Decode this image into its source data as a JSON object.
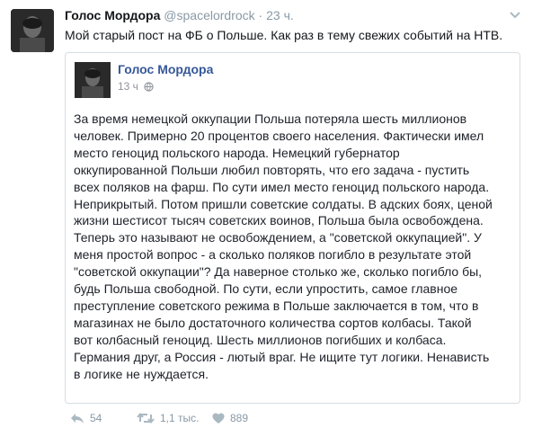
{
  "tweet": {
    "display_name": "Голос Мордора",
    "handle": "@spacelordrock",
    "dot": "·",
    "time": "23 ч.",
    "text": "Мой старый пост на ФБ о Польше. Как раз в тему свежих событий на НТВ."
  },
  "quote": {
    "author": "Голос Мордора",
    "time": "13 ч",
    "globe_icon": "globe-icon",
    "lines": [
      "За время немецкой оккупации Польша потеряла шесть миллионов",
      "человек. Примерно 20 процентов своего населения. Фактически имел",
      "место геноцид польского народа. Немецкий губернатор",
      "оккупированной Польши любил повторять, что его задача - пустить",
      "всех поляков на фарш. По сути имел место геноцид польского народа.",
      "Неприкрытый. Потом пришли советские солдаты. В адских боях, ценой",
      "жизни шестисот тысяч советских воинов, Польша была освобождена.",
      "Теперь это называют не освобождением, а \"советской оккупацией\". У",
      "меня простой вопрос - а сколько поляков погибло в результате этой",
      "\"советской оккупации\"? Да наверное столько же, сколько погибло бы,",
      "будь Польша свободной. По сути, если упростить, самое главное",
      "преступление советского режима в Польше заключается в том, что в",
      "магазинах не было достаточного количества сортов колбасы. Такой",
      "вот колбасный геноцид. Шесть миллионов погибших и колбаса.",
      "Германия друг, а Россия - лютый враг. Не ищите тут логики. Ненависть",
      "в логике не нуждается."
    ]
  },
  "actions": {
    "reply_count": "54",
    "retweet_count": "1,1 тыс.",
    "like_count": "889"
  },
  "colors": {
    "text": "#14171a",
    "muted": "#8899a6",
    "fb_link": "#365899",
    "border": "#d7dde2"
  }
}
